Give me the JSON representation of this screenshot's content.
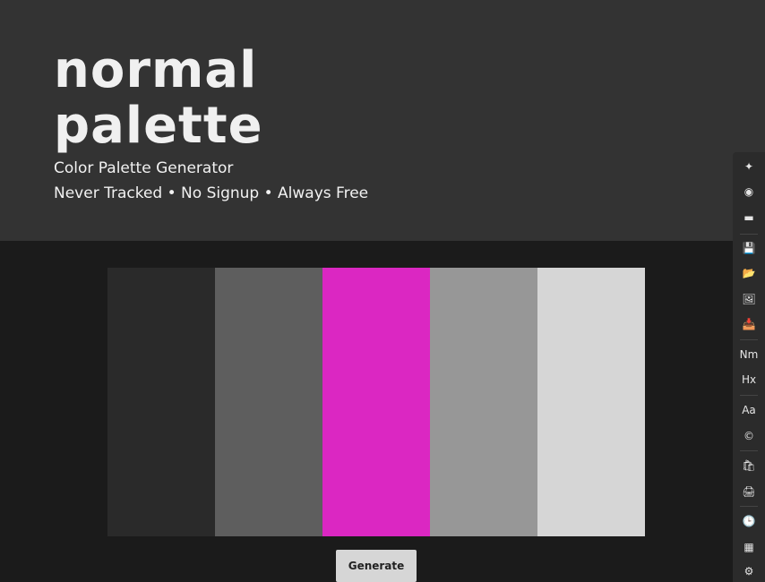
{
  "hero": {
    "brand_line1": "normal",
    "brand_line2": "palette",
    "subtitle": "Color Palette Generator",
    "tagline": "Never Tracked • No Signup • Always Free"
  },
  "palette": {
    "swatches": [
      "#2a2a2a",
      "#5e5e5e",
      "#db27c2",
      "#979797",
      "#d6d6d6"
    ]
  },
  "generate_label": "Generate",
  "toolbar": {
    "items": [
      {
        "icon": "sparkle-icon",
        "glyph": "✦"
      },
      {
        "icon": "eye-icon",
        "glyph": "◉"
      },
      {
        "icon": "gradient-icon",
        "glyph": "▬"
      },
      {
        "icon": "save-icon",
        "glyph": "💾"
      },
      {
        "icon": "folder-icon",
        "glyph": "📂"
      },
      {
        "icon": "image-icon",
        "glyph": "🖼"
      },
      {
        "icon": "inbox-icon",
        "glyph": "📥"
      },
      {
        "icon": "name-toggle",
        "glyph": "Nm"
      },
      {
        "icon": "hex-toggle",
        "glyph": "Hx"
      },
      {
        "icon": "font-icon",
        "glyph": "Aa"
      },
      {
        "icon": "copyright-icon",
        "glyph": "©"
      },
      {
        "icon": "shopping-bag-icon",
        "glyph": "🛍"
      },
      {
        "icon": "print-icon",
        "glyph": "🖨"
      },
      {
        "icon": "clock-icon",
        "glyph": "🕒"
      },
      {
        "icon": "grid-icon",
        "glyph": "▦"
      },
      {
        "icon": "gear-icon",
        "glyph": "⚙"
      }
    ]
  }
}
